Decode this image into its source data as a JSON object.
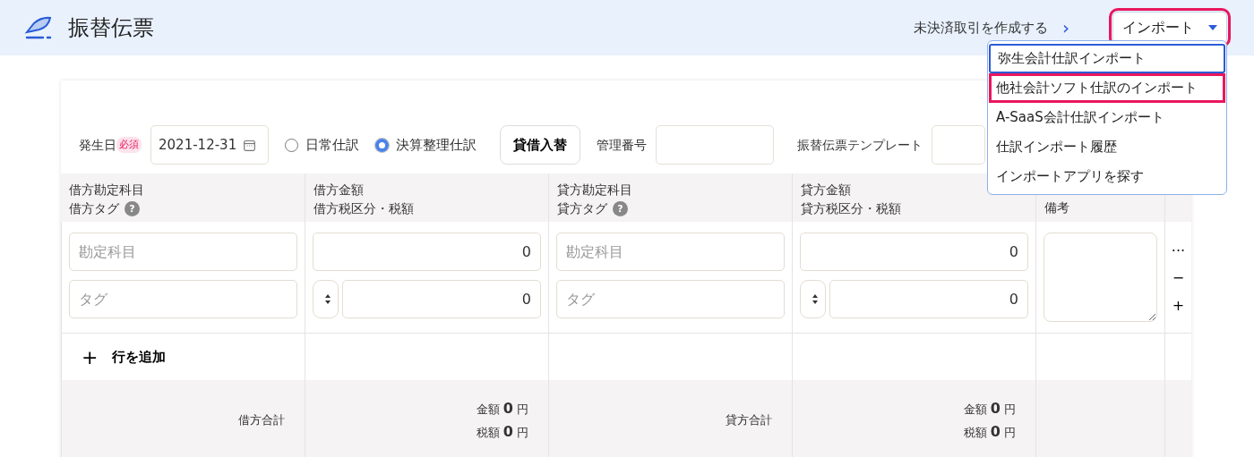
{
  "header": {
    "title": "振替伝票",
    "link": "未決済取引を作成する",
    "link_arrow": "›",
    "import_button": {
      "label": "インポート",
      "highlighted": true
    }
  },
  "import_menu": {
    "items": [
      {
        "label": "弥生会計仕訳インポート",
        "focused": true,
        "highlighted": false
      },
      {
        "label": "他社会計ソフト仕訳のインポート",
        "focused": false,
        "highlighted": true
      },
      {
        "label": "A-SaaS会計仕訳インポート",
        "focused": false,
        "highlighted": false
      },
      {
        "label": "仕訳インポート履歴",
        "focused": false,
        "highlighted": false
      },
      {
        "label": "インポートアプリを探す",
        "focused": false,
        "highlighted": false
      }
    ]
  },
  "form": {
    "date_label": "発生日",
    "required_badge": "必須",
    "date_value": "2021-12-31",
    "entry_types": [
      {
        "label": "日常仕訳",
        "selected": false
      },
      {
        "label": "決算整理仕訳",
        "selected": true
      }
    ],
    "swap_button": "貸借入替",
    "control_number_label": "管理番号",
    "template_label": "振替伝票テンプレート"
  },
  "table": {
    "columns": [
      {
        "lines": [
          "借方勘定科目",
          "借方タグ"
        ],
        "help": "?",
        "kind": "account",
        "account_placeholder": "勘定科目",
        "tag_placeholder": "タグ"
      },
      {
        "lines": [
          "借方金額",
          "借方税区分・税額"
        ],
        "kind": "amount",
        "amount": "0",
        "tax": "0"
      },
      {
        "lines": [
          "貸方勘定科目",
          "貸方タグ"
        ],
        "help": "?",
        "kind": "account",
        "account_placeholder": "勘定科目",
        "tag_placeholder": "タグ"
      },
      {
        "lines": [
          "貸方金額",
          "貸方税区分・税額"
        ],
        "kind": "amount",
        "amount": "0",
        "tax": "0"
      },
      {
        "lines": [
          "備考"
        ],
        "kind": "memo"
      }
    ],
    "row_actions": [
      "···",
      "−",
      "+"
    ],
    "add_row": {
      "icon": "+",
      "label": "行を追加"
    },
    "totals": [
      {
        "label": "借方合計",
        "amount_label": "金額",
        "amount": "0",
        "amount_unit": "円",
        "tax_label": "税額",
        "tax": "0",
        "tax_unit": "円"
      },
      {
        "label": "貸方合計",
        "amount_label": "金額",
        "amount": "0",
        "amount_unit": "円",
        "tax_label": "税額",
        "tax": "0",
        "tax_unit": "円"
      }
    ]
  }
}
